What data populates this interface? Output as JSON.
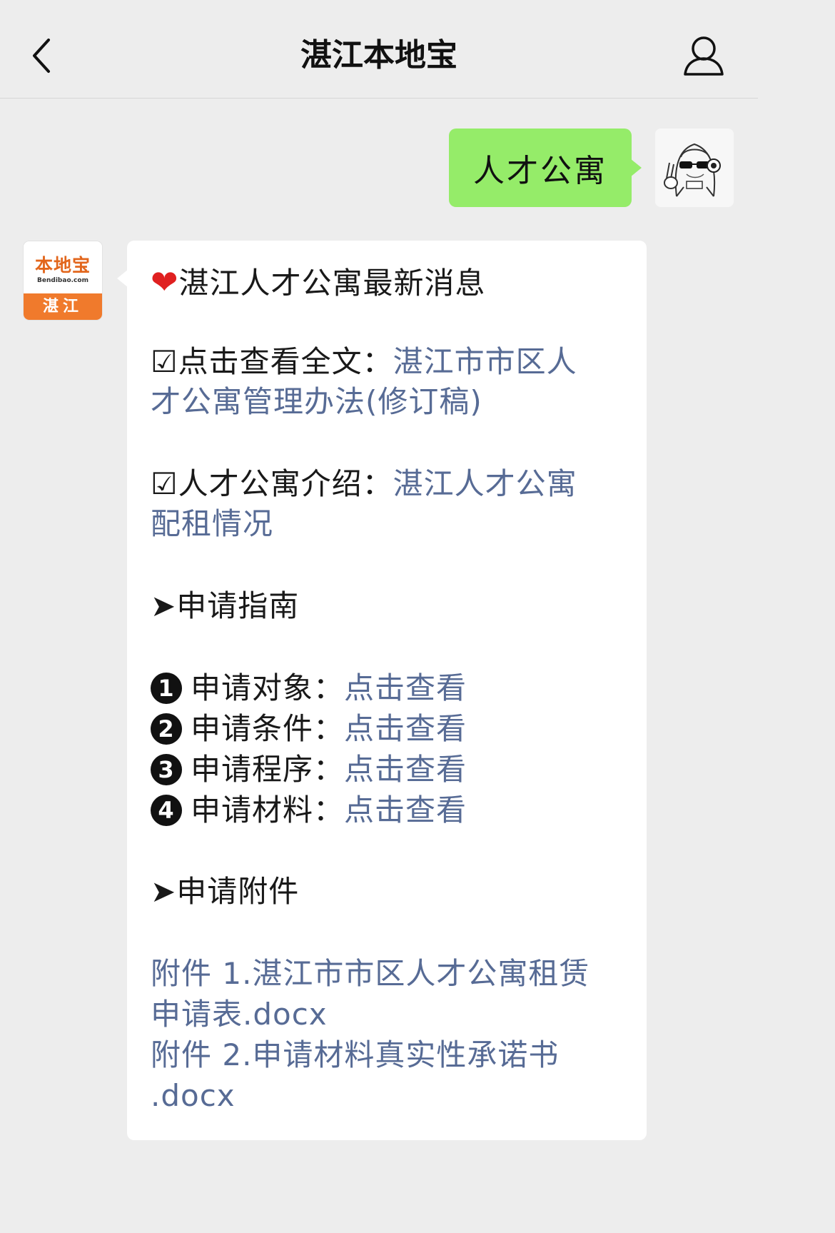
{
  "header": {
    "back_icon": "chevron-left-icon",
    "title": "湛江本地宝",
    "profile_icon": "user-icon"
  },
  "user_message": {
    "text": "人才公寓",
    "avatar": "anime-girl-headphones-avatar"
  },
  "bot": {
    "avatar": {
      "logo_text": "本地宝",
      "domain_text": "Bendibao.com",
      "city_text": "湛江"
    },
    "message": {
      "heading": {
        "icon": "heart-icon",
        "text": "湛江人才公寓最新消息"
      },
      "full_text": {
        "prefix": "☑点击查看全文：",
        "link_line1": "湛江市市区人",
        "link_line2": "才公寓管理办法(修订稿)"
      },
      "intro": {
        "prefix": "☑人才公寓介绍：",
        "link_line1": "湛江人才公寓",
        "link_line2": "配租情况"
      },
      "guide_heading": "➤申请指南",
      "guide_items": [
        {
          "num": "1",
          "label": "申请对象：",
          "link": "点击查看"
        },
        {
          "num": "2",
          "label": "申请条件：",
          "link": "点击查看"
        },
        {
          "num": "3",
          "label": "申请程序：",
          "link": "点击查看"
        },
        {
          "num": "4",
          "label": "申请材料：",
          "link": "点击查看"
        }
      ],
      "attachments_heading": "➤申请附件",
      "attachments": [
        {
          "line1": "附件 1.湛江市市区人才公寓租赁",
          "line2": "申请表.docx"
        },
        {
          "line1": "附件 2.申请材料真实性承诺书",
          "line2": ".docx"
        }
      ]
    }
  },
  "colors": {
    "background": "#ededed",
    "user_bubble": "#95ec69",
    "link": "#576b95",
    "brand_orange": "#f07a2c"
  }
}
